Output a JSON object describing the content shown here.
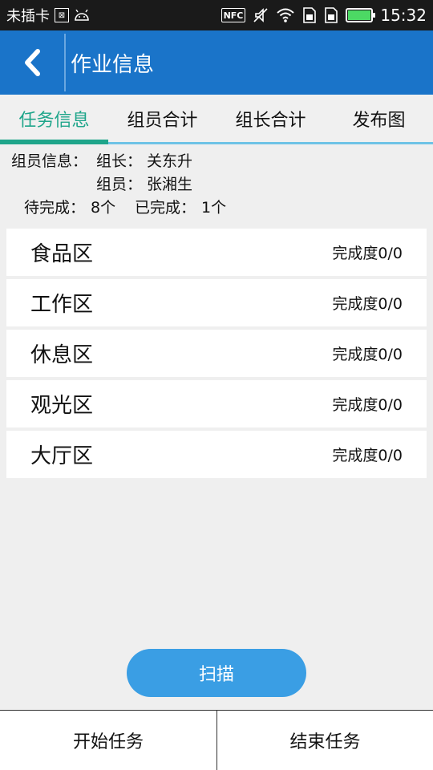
{
  "status_bar": {
    "carrier": "未插卡",
    "nfc_label": "NFC",
    "time": "15:32",
    "icons": [
      "sim-icon",
      "android-icon",
      "nfc-icon",
      "mute-icon",
      "wifi-icon",
      "sim-slot-1-icon",
      "sim-slot-2-icon",
      "battery-icon"
    ]
  },
  "header": {
    "title": "作业信息",
    "back_icon": "chevron-left-icon"
  },
  "tabs": [
    {
      "label": "任务信息",
      "active": true
    },
    {
      "label": "组员合计",
      "active": false
    },
    {
      "label": "组长合计",
      "active": false
    },
    {
      "label": "发布图",
      "active": false
    }
  ],
  "info": {
    "members_label": "组员信息：",
    "leader_label": "组长：",
    "leader_name": "关东升",
    "member_label": "组员：",
    "member_name": "张湘生",
    "pending_label": "待完成：",
    "pending_value": "8个",
    "done_label": "已完成：",
    "done_value": "1个"
  },
  "zones": [
    {
      "name": "食品区",
      "progress": "完成度0/0"
    },
    {
      "name": "工作区",
      "progress": "完成度0/0"
    },
    {
      "name": "休息区",
      "progress": "完成度0/0"
    },
    {
      "name": "观光区",
      "progress": "完成度0/0"
    },
    {
      "name": "大厅区",
      "progress": "完成度0/0"
    }
  ],
  "scan_button": {
    "label": "扫描"
  },
  "bottom_bar": {
    "start_label": "开始任务",
    "end_label": "结束任务"
  },
  "colors": {
    "header_bg": "#1a74c9",
    "tab_active": "#1ea58a",
    "tab_underline": "#6ec3e6",
    "scan_button_bg": "#3a9ee4",
    "background": "#efefef"
  }
}
